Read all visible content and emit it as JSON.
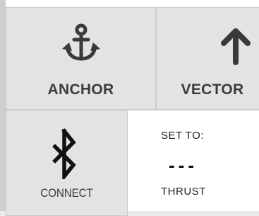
{
  "tiles": {
    "anchor": {
      "label": "ANCHOR",
      "icon": "anchor-icon"
    },
    "vector": {
      "label": "VECTOR",
      "icon": "arrow-up-icon"
    },
    "connect": {
      "label": "CONNECT",
      "icon": "bluetooth-icon"
    }
  },
  "status": {
    "set_label": "SET TO:",
    "set_value": "---",
    "thrust_label": "THRUST"
  },
  "colors": {
    "tile_bg": "#e3e3e3",
    "panel_bg": "#ffffff",
    "icon": "#3a3a3a",
    "label": "#3c3c3c"
  }
}
